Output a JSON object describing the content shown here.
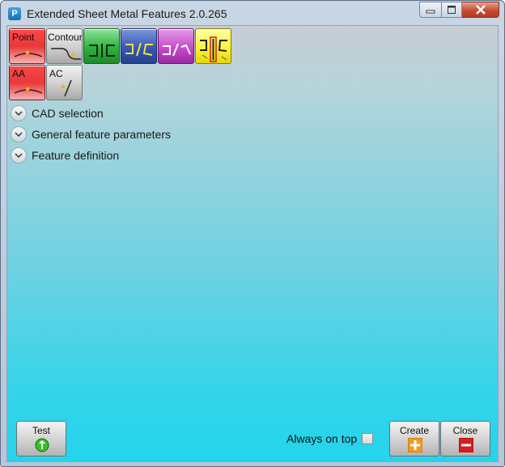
{
  "window": {
    "title": "Extended Sheet Metal Features 2.0.265",
    "app_icon_letter": "P"
  },
  "toolbar": {
    "point_label": "Point",
    "contour_label": "Contour",
    "aa_label": "AA",
    "ac_label": "AC"
  },
  "sections": {
    "cad_selection": "CAD selection",
    "general_params": "General feature parameters",
    "feature_definition": "Feature definition"
  },
  "footer": {
    "test_label": "Test",
    "always_on_top_label": "Always on top",
    "create_label": "Create",
    "close_label": "Close"
  },
  "colors": {
    "accent_red": "#e83838",
    "create_orange": "#f29a1c",
    "close_red": "#d81e1e",
    "test_green": "#3bbf2c"
  }
}
